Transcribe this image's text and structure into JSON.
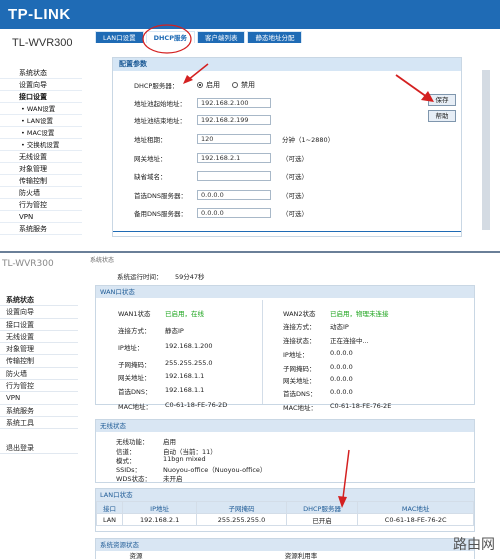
{
  "screen1": {
    "logo": "TP-LINK",
    "model": "TL-WVR300",
    "tabs": [
      "LAN口设置",
      "DHCP服务",
      "客户端列表",
      "静态地址分配"
    ],
    "nav": [
      "系统状态",
      "设置向导",
      "接口设置",
      "• WAN设置",
      "• LAN设置",
      "• MAC设置",
      "• 交换机设置",
      "无线设置",
      "对象管理",
      "传输控制",
      "防火墙",
      "行为管控",
      "VPN",
      "系统服务"
    ],
    "panel_title": "配置参数",
    "dhcp_label": "DHCP服务器：",
    "enable": "启用",
    "disable": "禁用",
    "start_label": "地址池起始地址：",
    "start_value": "192.168.2.100",
    "end_label": "地址池结束地址：",
    "end_value": "192.168.2.199",
    "lease_label": "地址租期：",
    "lease_value": "120",
    "lease_note": "分钟（1~2880）",
    "gw_label": "网关地址：",
    "gw_value": "192.168.2.1",
    "optional": "（可选）",
    "domain_label": "缺省域名：",
    "domain_value": "",
    "dns1_label": "首选DNS服务器：",
    "dns1_value": "0.0.0.0",
    "dns2_label": "备用DNS服务器：",
    "dns2_value": "0.0.0.0",
    "save": "保存",
    "help": "帮助"
  },
  "screen2": {
    "cut_model": "TL-WVR300",
    "top_label": "系统状态",
    "uptime_label": "系统运行时间：",
    "uptime_value": "59分47秒",
    "nav": [
      "系统状态",
      "设置向导",
      "接口设置",
      "无线设置",
      "对象管理",
      "传输控制",
      "防火墙",
      "行为管控",
      "VPN",
      "系统服务",
      "系统工具",
      "",
      "退出登录"
    ],
    "wan_title": "WAN口状态",
    "wan1": {
      "status_k": "WAN1状态",
      "status_v": "已启用，在线",
      "type_k": "连接方式：",
      "type_v": "静态IP",
      "ip_k": "IP地址：",
      "ip_v": "192.168.1.200",
      "mask_k": "子网掩码：",
      "mask_v": "255.255.255.0",
      "gw_k": "网关地址：",
      "gw_v": "192.168.1.1",
      "dns_k": "首选DNS：",
      "dns_v": "192.168.1.1",
      "mac_k": "MAC地址：",
      "mac_v": "C0-61-18-FE-76-2D"
    },
    "wan2": {
      "status_k": "WAN2状态",
      "status_v": "已启用，物理未连接",
      "type_k": "连接方式：",
      "type_v": "动态IP",
      "state_k": "连接状态：",
      "state_v": "正在连接中...",
      "ip_k": "IP地址：",
      "ip_v": "0.0.0.0",
      "mask_k": "子网掩码：",
      "mask_v": "0.0.0.0",
      "gw_k": "网关地址：",
      "gw_v": "0.0.0.0",
      "dns_k": "首选DNS：",
      "dns_v": "0.0.0.0",
      "mac_k": "MAC地址：",
      "mac_v": "C0-61-18-FE-76-2E"
    },
    "wl_title": "无线状态",
    "wl": {
      "func_k": "无线功能：",
      "func_v": "启用",
      "ch_k": "信道：",
      "ch_v": "自动（当前：11）",
      "mode_k": "模式：",
      "mode_v": "11bgn mixed",
      "ssid_k": "SSIDs：",
      "ssid_v": "Nuoyou-office（Nuoyou-office）",
      "wds_k": "WDS状态：",
      "wds_v": "未开启"
    },
    "lan_title": "LAN口状态",
    "lan_headers": [
      "接口",
      "IP地址",
      "子网掩码",
      "DHCP服务器",
      "MAC地址"
    ],
    "lan_row": [
      "LAN",
      "192.168.2.1",
      "255.255.255.0",
      "已开启",
      "C0-61-18-FE-76-2C"
    ],
    "res_title": "系统资源状态",
    "res_headers": [
      "资源",
      "资源利用率"
    ],
    "watermark": "路由网"
  }
}
